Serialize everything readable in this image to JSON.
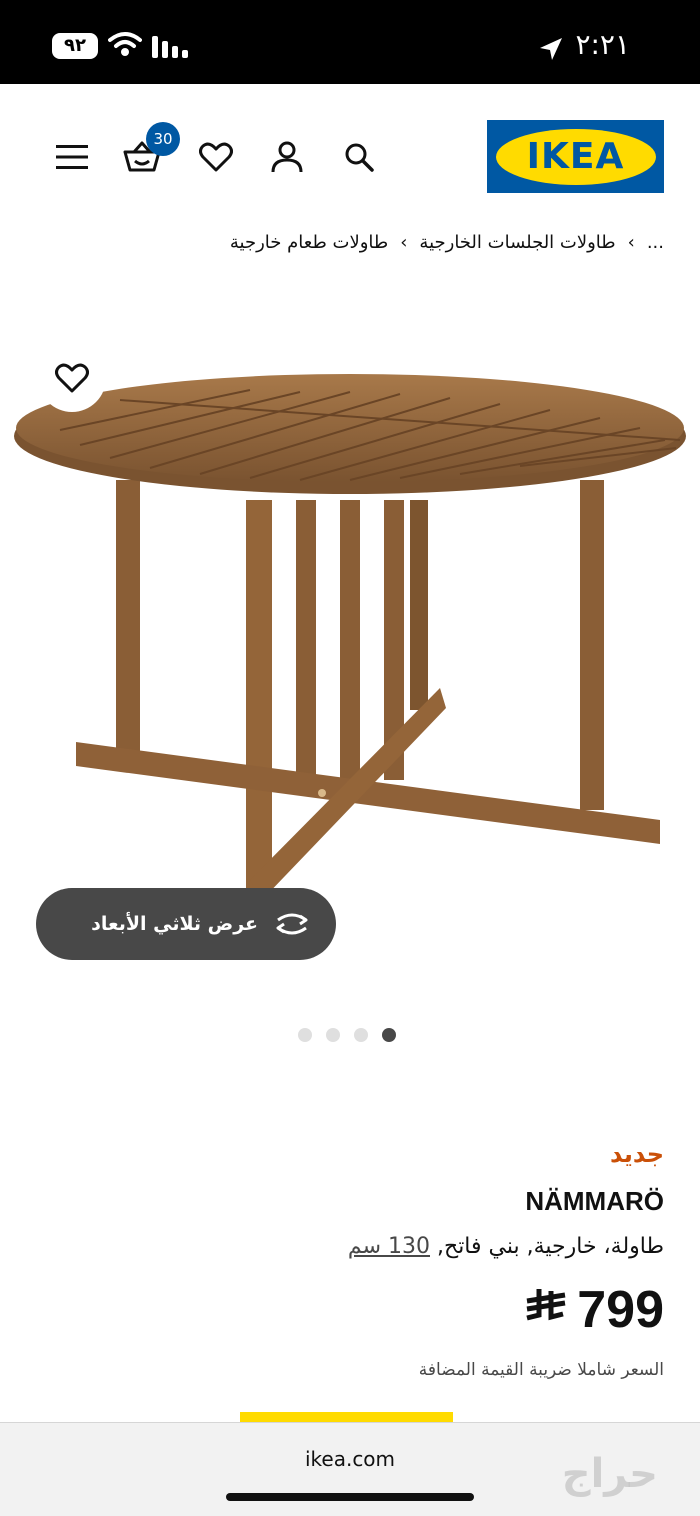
{
  "status_bar": {
    "battery": "٩٢",
    "time": "٢:٢١"
  },
  "header": {
    "logo_text": "IKEA",
    "cart_count": "30",
    "icons": [
      "menu-icon",
      "cart-icon",
      "heart-icon",
      "profile-icon",
      "search-icon"
    ]
  },
  "breadcrumb": {
    "ellipsis": "...",
    "items": [
      "طاولات الجلسات الخارجية",
      "طاولات طعام خارجية"
    ]
  },
  "gallery": {
    "view3d_label": "عرض ثلاثي الأبعاد",
    "dot_count": 4,
    "active_dot": 3
  },
  "product": {
    "tag": "جديد",
    "name": "NÄMMARÖ",
    "description": "طاولة، خارجية, بني فاتح, ",
    "size_link": "130 سم",
    "price_value": "799",
    "price_currency": "⃁",
    "vat_note": "السعر شاملا ضريبة القيمة المضافة"
  },
  "browser": {
    "url": "ikea.com",
    "watermark": "حراج"
  },
  "colors": {
    "ikea_blue": "#0058a3",
    "ikea_yellow": "#ffdb00",
    "new_tag": "#ca5008",
    "pill_bg": "#484848"
  }
}
